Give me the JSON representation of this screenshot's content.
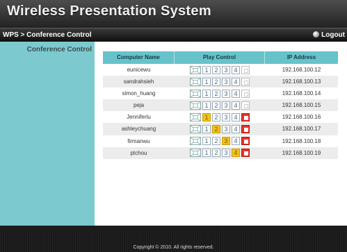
{
  "app": {
    "title": "Wireless Presentation System"
  },
  "nav": {
    "breadcrumb": "WPS > Conference Control",
    "logout_label": "Logout"
  },
  "sidebar": {
    "items": [
      {
        "label": "Conference Control"
      }
    ]
  },
  "table": {
    "headers": [
      "Computer Name",
      "Play Control",
      "IP Address"
    ],
    "rows": [
      {
        "name": "eunicewu",
        "ip": "192.168.100.12",
        "active": 0
      },
      {
        "name": "sandrahsieh",
        "ip": "192.168.100.13",
        "active": 0
      },
      {
        "name": "simon_huang",
        "ip": "192.168.100.14",
        "active": 0
      },
      {
        "name": "peja",
        "ip": "192.168.100.15",
        "active": 0
      },
      {
        "name": "Jenniferlu",
        "ip": "192.168.100.16",
        "active": 1
      },
      {
        "name": "ashleychuang",
        "ip": "192.168.100.17",
        "active": 2
      },
      {
        "name": "firmanwu",
        "ip": "192.168.100.18",
        "active": 3
      },
      {
        "name": "ptchou",
        "ip": "192.168.100.19",
        "active": 4
      }
    ],
    "play_buttons": [
      "1",
      "2",
      "3",
      "4"
    ]
  },
  "colors": {
    "sidebar": "#7ccad0",
    "header": "#67c2ca",
    "active_slot": "#f3c21c",
    "stop_active": "#e8322a"
  },
  "icons": {
    "quad": "quad-split-icon",
    "stop": "stop-icon",
    "logout": "logout-icon"
  },
  "footer": {
    "copyright": "Copyright © 2010. All rights reserved."
  }
}
